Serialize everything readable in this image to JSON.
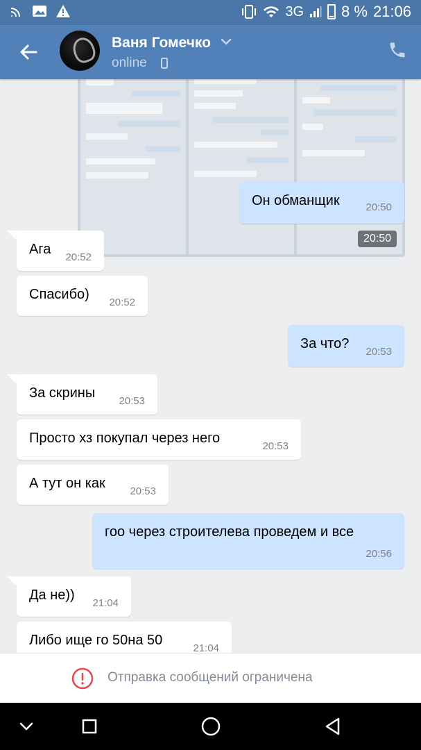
{
  "status_bar": {
    "network": "3G",
    "battery": "8 %",
    "time": "21:06"
  },
  "header": {
    "contact_name": "Ваня Гомечко",
    "status": "online"
  },
  "photo": {
    "time": "20:50"
  },
  "messages": [
    {
      "dir": "out",
      "text": "Он обманщик",
      "time": "20:50"
    },
    {
      "dir": "in",
      "text": "Ага",
      "time": "20:52"
    },
    {
      "dir": "in",
      "text": "Спасибо)",
      "time": "20:52"
    },
    {
      "dir": "out",
      "text": "За что?",
      "time": "20:53"
    },
    {
      "dir": "in",
      "text": "За скрины",
      "time": "20:53"
    },
    {
      "dir": "in",
      "text": "Просто хз покупал через него",
      "time": "20:53"
    },
    {
      "dir": "in",
      "text": "А тут он как",
      "time": "20:53"
    },
    {
      "dir": "out",
      "text": "гоо через строителева проведем и все",
      "time": "20:56"
    },
    {
      "dir": "in",
      "text": "Да не))",
      "time": "21:04"
    },
    {
      "dir": "in",
      "text": "Либо ище го 50на 50",
      "time": "21:04"
    }
  ],
  "footer": {
    "restriction_text": "Отправка сообщений ограничена"
  },
  "colors": {
    "header": "#5181b8",
    "status_bar": "#4a76a8",
    "outgoing_bubble": "#cce4ff",
    "incoming_bubble": "#ffffff",
    "warning": "#e64646"
  },
  "icons": [
    "back-arrow-icon",
    "chevron-down-icon",
    "phone-call-icon",
    "warning-icon",
    "nav-back-icon",
    "nav-home-icon",
    "nav-recents-icon",
    "nav-hide-icon"
  ]
}
